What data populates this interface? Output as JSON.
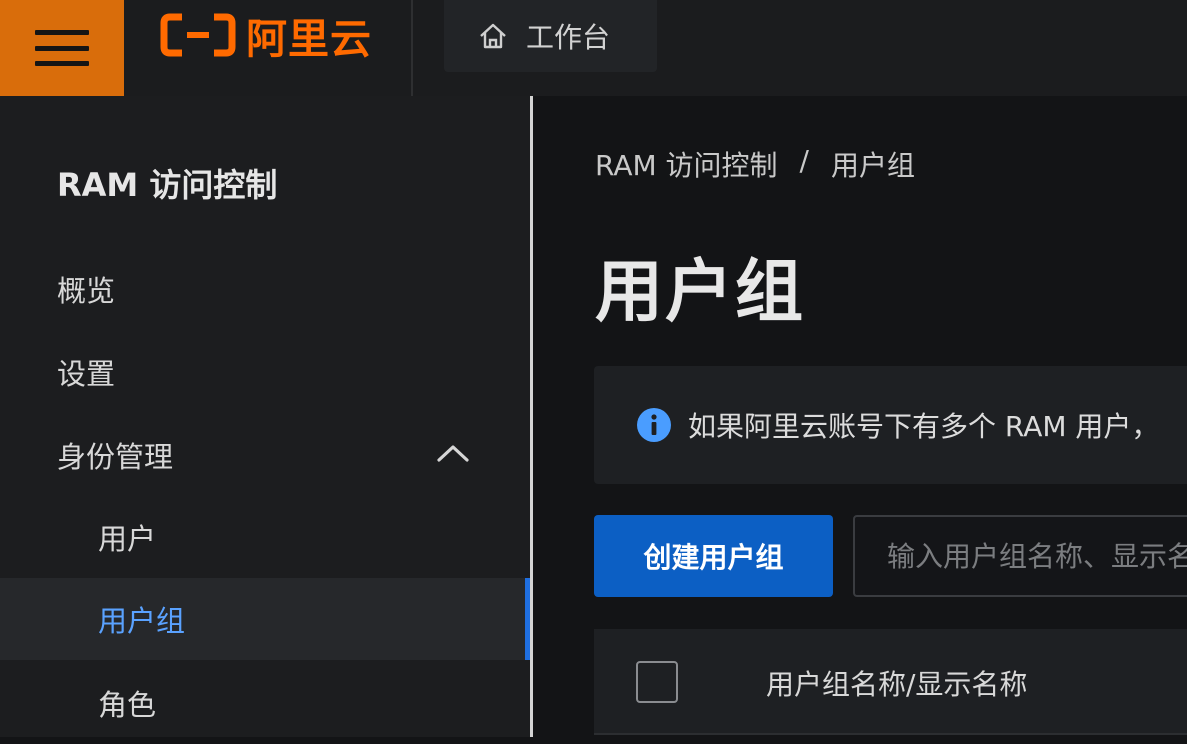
{
  "colors": {
    "brand": "#ff6a00",
    "menu_bg": "#d96d0b",
    "primary_button": "#0c5fc4",
    "active_link": "#5aa2ff",
    "info_icon": "#4a9dff"
  },
  "topbar": {
    "logo_text": "阿里云",
    "logo_icon": "aliyun-bracket-icon",
    "menu_icon": "hamburger-icon",
    "workbench": {
      "icon": "home-icon",
      "label": "工作台"
    }
  },
  "sidebar": {
    "title": "RAM 访问控制",
    "items": [
      {
        "label": "概览",
        "level": 1
      },
      {
        "label": "设置",
        "level": 1
      },
      {
        "label": "身份管理",
        "level": 1,
        "expanded": true,
        "icon": "chevron-up-icon"
      },
      {
        "label": "用户",
        "level": 2
      },
      {
        "label": "用户组",
        "level": 2,
        "active": true
      },
      {
        "label": "角色",
        "level": 2
      }
    ]
  },
  "main": {
    "breadcrumb": {
      "root": "RAM 访问控制",
      "separator": "/",
      "current": "用户组"
    },
    "title": "用户组",
    "notice": {
      "icon": "info-icon",
      "text": "如果阿里云账号下有多个 RAM 用户，"
    },
    "toolbar": {
      "create_label": "创建用户组",
      "search_placeholder": "输入用户组名称、显示名称"
    },
    "table": {
      "columns": [
        "用户组名称/显示名称"
      ]
    }
  }
}
